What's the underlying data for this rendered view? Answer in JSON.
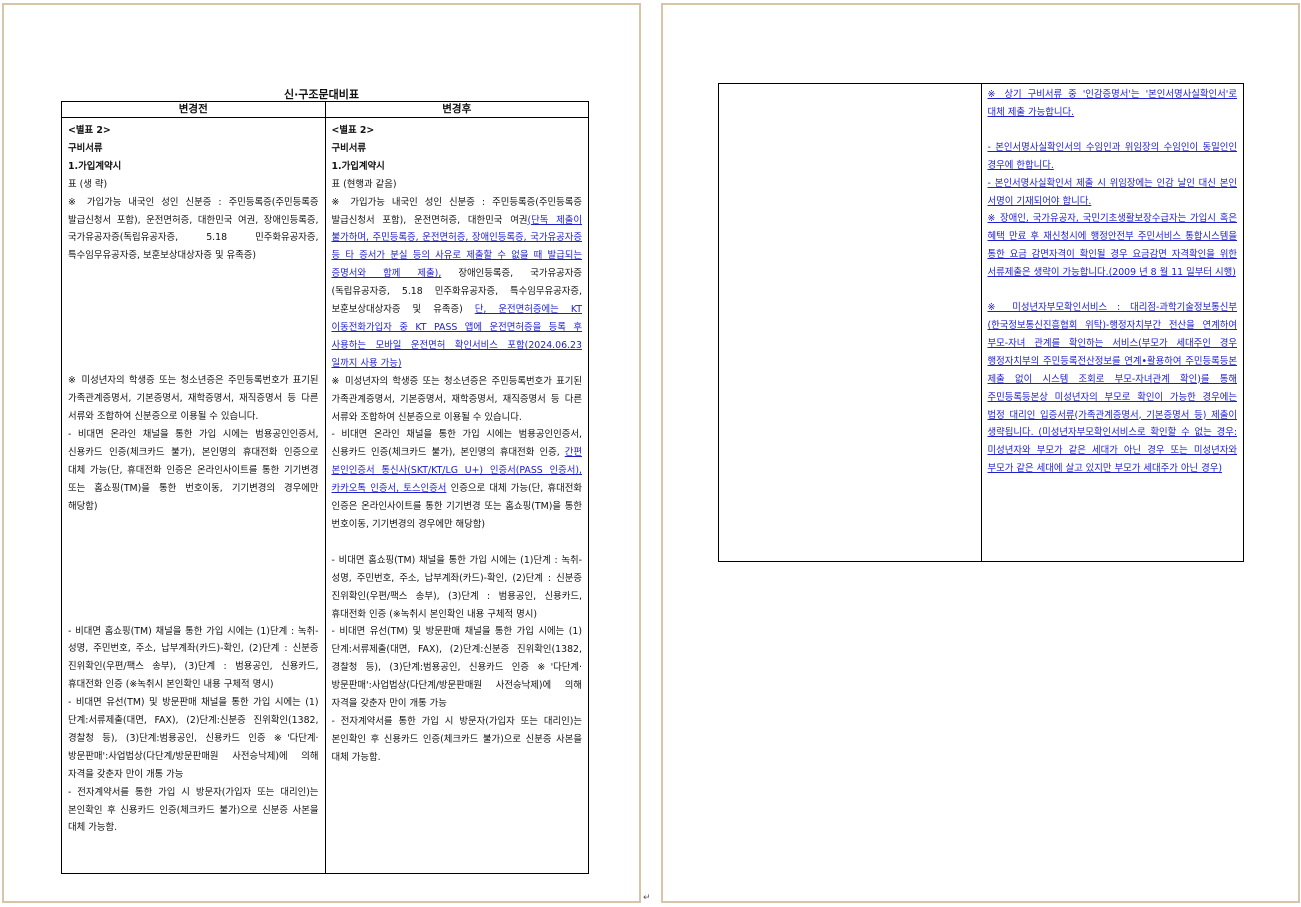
{
  "page1": {
    "title": "신·구조문대비표",
    "header_before": "변경전",
    "header_after": "변경후",
    "before": {
      "annex": "<별표 2>",
      "heading": "구비서류",
      "section": "1.가입계약시",
      "table_note": "표 (생 략)",
      "p1": "※ 가입가능 내국인 성인 신분증 : 주민등록증(주민등록증 발급신청서 포함), 운전면허증, 대한민국 여권, 장애인등록증, 국가유공자증(독립유공자증, 5.18 민주화유공자증, 특수임무유공자증, 보훈보상대상자증 및 유족증)",
      "p2": "※ 미성년자의 학생증 또는 청소년증은 주민등록번호가 표기된 가족관계증명서, 기본증명서, 재학증명서, 재직증명서 등 다른 서류와 조합하여 신분증으로 이용될 수 있습니다.",
      "p3": "- 비대면 온라인 채널을 통한 가입 시에는 범용공인인증서, 신용카드 인증(체크카드 불가), 본인명의 휴대전화 인증으로 대체 가능(단, 휴대전화 인증은 온라인사이트를 통한 기기변경 또는 홈쇼핑(TM)을 통한 번호이동, 기기변경의 경우에만 해당함)",
      "p4": "- 비대면 홈쇼핑(TM) 채널을 통한 가입 시에는 (1)단계 : 녹취-성명, 주민번호, 주소, 납부계좌(카드)-확인, (2)단계 : 신분증 진위확인(우편/팩스 송부), (3)단계 : 범용공인, 신용카드, 휴대전화 인증 (※녹취시 본인확인 내용 구체적 명시)",
      "p5": "- 비대면 유선(TM) 및 방문판매 채널을 통한 가입 시에는 (1)단계:서류제출(대면, FAX), (2)단계:신분증 진위확인(1382, 경찰청 등), (3)단계:범용공인, 신용카드 인증 ※'다단계· 방문판매':사업법상(다단계/방문판매원 사전승낙제)에 의해 자격을 갖춘자 만이 개통 가능",
      "p6": "- 전자계약서를 통한 가입 시 방문자(가입자 또는 대리인)는 본인확인 후 신용카드 인증(체크카드 불가)으로 신분증 사본을 대체 가능함."
    },
    "after": {
      "annex": "<별표 2>",
      "heading": "구비서류",
      "section": "1.가입계약시",
      "table_note": "표 (현행과 같음)",
      "p1_a": "※ 가입가능 내국인 성인 신분증 : 주민등록증(주민등록증 발급신청서 포함), 운전면허증, 대한민국 여권",
      "p1_b": "(단독 제출이 불가하며, 주민등록증, 운전면허증, 장애인등록증, 국가유공자증 등 타 증서가 분실 등의 사유로 제출할 수 없을 때 발급되는 증명서와 함께 제출),",
      "p1_c": " 장애인등록증, 국가유공자증(독립유공자증, 5.18 민주화유공자증, 특수임무유공자증, 보훈보상대상자증 및 유족증) ",
      "p1_d": "단, 운전면허증에는 KT 이동전화가입자 중 KT PASS 앱에 운전면허증을 등록 후 사용하는 모바일 운전면허 확인서비스 포함(2024.06.23 일까지 사용 가능)",
      "p2": "※ 미성년자의 학생증 또는 청소년증은 주민등록번호가 표기된 가족관계증명서, 기본증명서, 재학증명서, 재직증명서 등 다른 서류와 조합하여 신분증으로 이용될 수 있습니다.",
      "p3_a": "- 비대면 온라인 채널을 통한 가입 시에는 범용공인인증서, 신용카드 인증(체크카드 불가), 본인명의 휴대전화 인증, ",
      "p3_b": "간편 본인인증서 통신사(SKT/KT/LG U+) 인증서(PASS 인증서), 카카오톡 인증서, 토스인증서",
      "p3_c": " 인증으로 대체 가능(단, 휴대전화 인증은 온라인사이트를 통한 기기변경 또는 홈쇼핑(TM)을 통한 번호이동, 기기변경의 경우에만 해당함)",
      "p4": "- 비대면 홈쇼핑(TM) 채널을 통한 가입 시에는 (1)단계 : 녹취-성명, 주민번호, 주소, 납부계좌(카드)-확인, (2)단계 : 신분증 진위확인(우편/팩스 송부), (3)단계 : 범용공인, 신용카드, 휴대전화 인증 (※녹취시 본인확인 내용 구체적 명시)",
      "p5": "- 비대면 유선(TM) 및 방문판매 채널을 통한 가입 시에는 (1)단계:서류제출(대면, FAX), (2)단계:신분증 진위확인(1382, 경찰청 등), (3)단계:범용공인, 신용카드 인증 ※'다단계· 방문판매':사업법상(다단계/방문판매원 사전승낙제)에 의해 자격을 갖춘자 만이 개통 가능",
      "p6": "- 전자계약서를 통한 가입 시 방문자(가입자 또는 대리인)는 본인확인 후 신용카드 인증(체크카드 불가)으로 신분증 사본을 대체 가능함."
    }
  },
  "page2": {
    "after": {
      "q1": "※ 상기 구비서류 중 '인감증명서'는 '본인서명사실확인서'로 대체 제출 가능합니다.",
      "q2": "- 본인서명사실확인서의 수임인과 위임장의 수임인이 동일인인 경우에 한합니다.",
      "q3": "- 본인서명사실확인서 제출 시 위임장에는 인감 날인 대신 본인 서명이 기재되어야 합니다.",
      "q4": "※ 장애인, 국가유공자, 국민기초생활보장수급자는 가입시 혹은 혜택 만료 후 재신청시에 행정안전부 주민서비스 통합시스템을 통한 요금 감면자격이 확인될 경우 요금감면 자격확인을 위한 서류제출은 생략이 가능합니다.(2009 년 8 월 11 일부터 시행)",
      "q5": "※ 미성년자부모확인서비스 : 대리점-과학기술정보통신부(한국정보통신진흥협회 위탁)-행정자치부간 전산을 연계하여 부모-자녀 관계를 확인하는 서비스(부모가 세대주인 경우 행정자치부의 주민등록전산정보를 연계•활용하여 주민등록등본 제출 없이 시스템 조회로 부모-자녀관계 확인)를 통해 주민등록등본상 미성년자의 부모로 확인이 가능한 경우에는 법정 대리인 입증서류(가족관계증명서, 기본증명서 등) 제출이 생략됩니다. (미성년자부모확인서비스로 확인할 수 없는 경우: 미성년자와 부모가 같은 세대가 아닌 경우 또는 미성년자와 부모가 같은 세대에 살고 있지만 부모가 세대주가 아닌 경우)"
    }
  },
  "para_mark": "↵"
}
